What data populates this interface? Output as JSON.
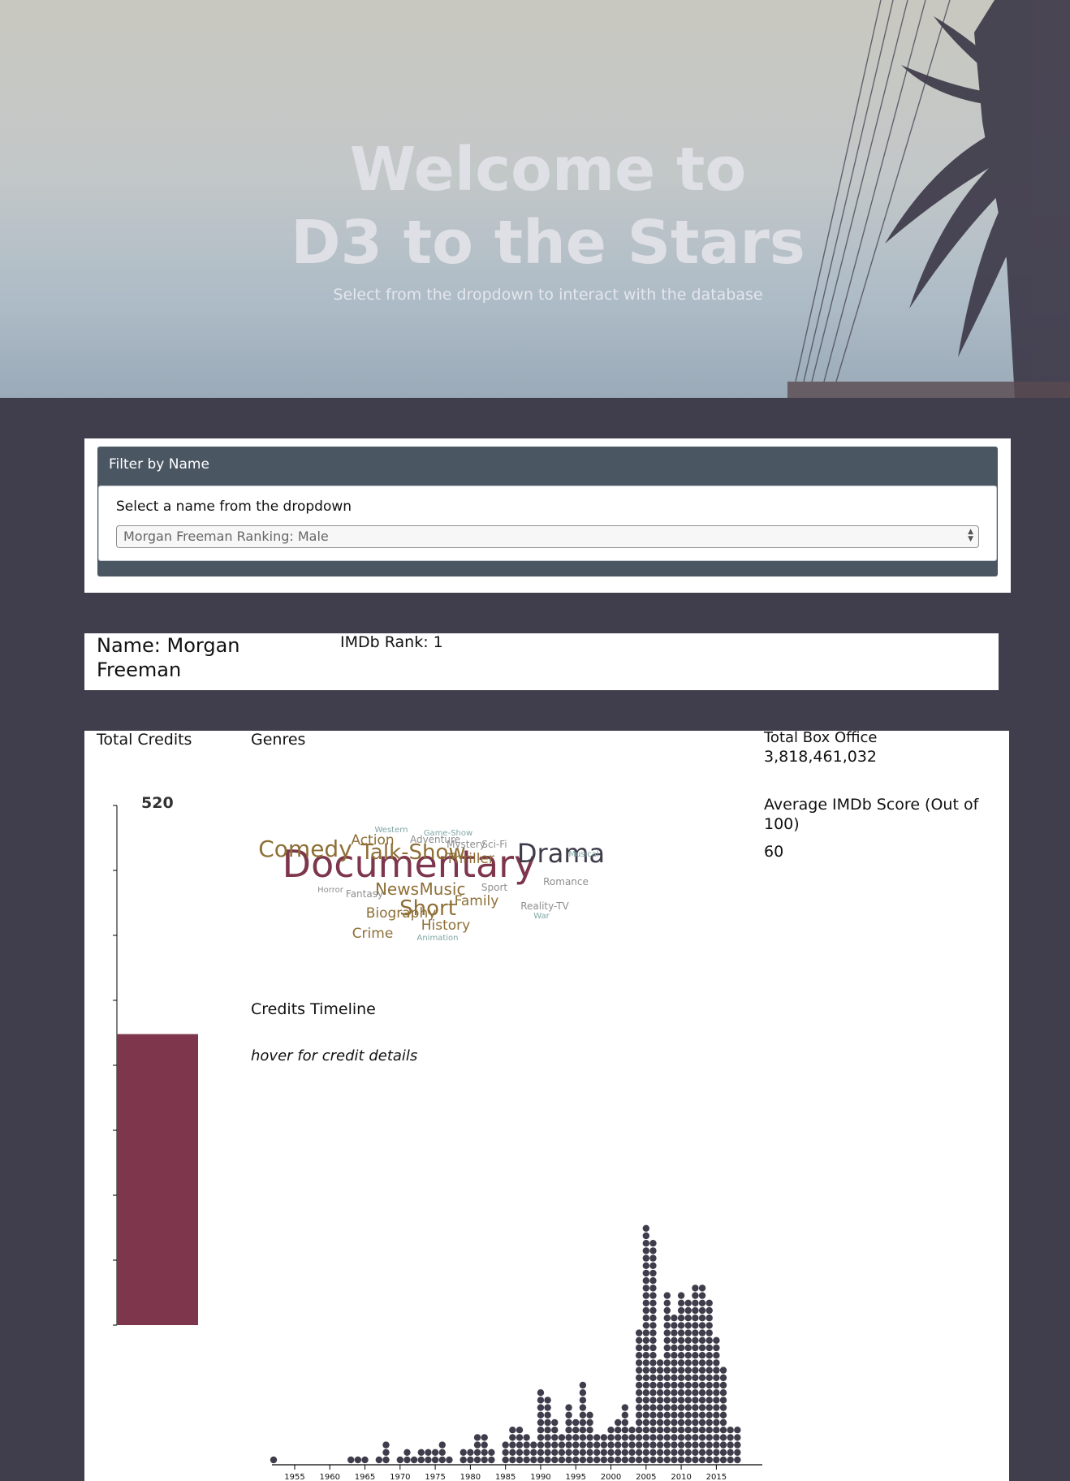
{
  "hero": {
    "title_line1": "Welcome to",
    "title_line2": "D3 to the Stars",
    "subtitle": "Select from the dropdown to interact with the database"
  },
  "filter": {
    "heading": "Filter by Name",
    "label": "Select a name from the dropdown",
    "selected": "Morgan Freeman Ranking: Male"
  },
  "person": {
    "name": "Name: Morgan Freeman",
    "rank": "IMDb Rank: 1"
  },
  "stats": {
    "total_credits_title": "Total Credits",
    "total_credits_value": "520",
    "genres_title": "Genres",
    "box_office_title": "Total Box Office",
    "box_office_value": "3,818,461,032",
    "imdb_score_title": "Average IMDb Score (Out of 100)",
    "imdb_score_value": "60",
    "timeline_title": "Credits Timeline",
    "timeline_hint": "hover for credit details"
  },
  "colors": {
    "maroon": "#7d364c",
    "gold": "#8e6f36",
    "dark": "#3f3d4b",
    "teal": "#7fa6a4",
    "grey": "#8e8e8e"
  },
  "genres": [
    {
      "word": "Documentary",
      "weight": 10,
      "color": "maroon"
    },
    {
      "word": "Drama",
      "weight": 7,
      "color": "dark"
    },
    {
      "word": "Comedy",
      "weight": 6,
      "color": "gold"
    },
    {
      "word": "Talk-Show",
      "weight": 5,
      "color": "gold"
    },
    {
      "word": "Short",
      "weight": 5,
      "color": "gold"
    },
    {
      "word": "News",
      "weight": 4,
      "color": "gold"
    },
    {
      "word": "Music",
      "weight": 4,
      "color": "gold"
    },
    {
      "word": "Thriller",
      "weight": 3,
      "color": "gold"
    },
    {
      "word": "Action",
      "weight": 3,
      "color": "gold"
    },
    {
      "word": "Biography",
      "weight": 3,
      "color": "gold"
    },
    {
      "word": "Crime",
      "weight": 3,
      "color": "gold"
    },
    {
      "word": "History",
      "weight": 3,
      "color": "gold"
    },
    {
      "word": "Family",
      "weight": 3,
      "color": "gold"
    },
    {
      "word": "Adventure",
      "weight": 2,
      "color": "grey"
    },
    {
      "word": "Mystery",
      "weight": 2,
      "color": "grey"
    },
    {
      "word": "Sci-Fi",
      "weight": 2,
      "color": "grey"
    },
    {
      "word": "Reality-TV",
      "weight": 2,
      "color": "grey"
    },
    {
      "word": "Fantasy",
      "weight": 2,
      "color": "grey"
    },
    {
      "word": "Romance",
      "weight": 2,
      "color": "grey"
    },
    {
      "word": "Sport",
      "weight": 2,
      "color": "grey"
    },
    {
      "word": "Horror",
      "weight": 1,
      "color": "grey"
    },
    {
      "word": "War",
      "weight": 1,
      "color": "teal"
    },
    {
      "word": "Western",
      "weight": 1,
      "color": "teal"
    },
    {
      "word": "Game-Show",
      "weight": 1,
      "color": "teal"
    },
    {
      "word": "Musical",
      "weight": 1,
      "color": "teal"
    },
    {
      "word": "Animation",
      "weight": 1,
      "color": "teal"
    }
  ],
  "chart_data": [
    {
      "type": "bar",
      "categories": [
        "Total Credits"
      ],
      "values": [
        520
      ],
      "ylim": [
        0,
        520
      ],
      "title": "Total Credits"
    },
    {
      "type": "scatter",
      "title": "Credits Timeline",
      "x_ticks": [
        1955,
        1960,
        1965,
        1970,
        1975,
        1980,
        1985,
        1990,
        1995,
        2000,
        2005,
        2010,
        2015
      ],
      "xlim": [
        1952,
        2019
      ],
      "x": [
        1952,
        1963,
        1964,
        1965,
        1967,
        1968,
        1970,
        1971,
        1972,
        1973,
        1974,
        1975,
        1976,
        1977,
        1979,
        1980,
        1981,
        1982,
        1983,
        1985,
        1986,
        1987,
        1988,
        1989,
        1990,
        1991,
        1992,
        1993,
        1994,
        1995,
        1996,
        1997,
        1998,
        1999,
        2000,
        2001,
        2002,
        2003,
        2004,
        2005,
        2006,
        2007,
        2008,
        2009,
        2010,
        2011,
        2012,
        2013,
        2014,
        2015,
        2016,
        2017,
        2018
      ],
      "y": [
        1,
        1,
        1,
        1,
        1,
        3,
        1,
        2,
        1,
        2,
        2,
        2,
        3,
        1,
        2,
        2,
        4,
        4,
        2,
        3,
        5,
        5,
        4,
        3,
        10,
        9,
        6,
        4,
        8,
        6,
        11,
        7,
        4,
        4,
        5,
        6,
        8,
        5,
        18,
        32,
        30,
        14,
        23,
        20,
        23,
        22,
        24,
        24,
        22,
        17,
        13,
        5,
        5
      ]
    }
  ]
}
